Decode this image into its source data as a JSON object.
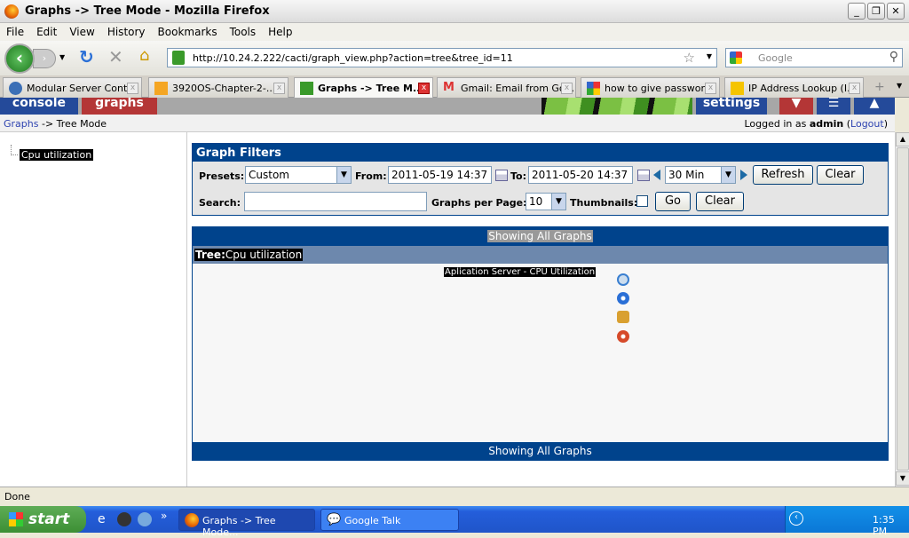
{
  "window": {
    "title": "Graphs -> Tree Mode - Mozilla Firefox"
  },
  "menu": [
    "File",
    "Edit",
    "View",
    "History",
    "Bookmarks",
    "Tools",
    "Help"
  ],
  "nav": {
    "url": "http://10.24.2.222/cacti/graph_view.php?action=tree&tree_id=11",
    "search_placeholder": "Google"
  },
  "tabs": [
    {
      "label": "Modular Server Cont...",
      "active": false
    },
    {
      "label": "3920OS-Chapter-2-...",
      "active": false
    },
    {
      "label": "Graphs -> Tree M...",
      "active": true
    },
    {
      "label": "Gmail: Email from Go...",
      "active": false
    },
    {
      "label": "how to give passwor...",
      "active": false
    },
    {
      "label": "IP Address Lookup (I...",
      "active": false
    }
  ],
  "cacti": {
    "console": "console",
    "graphs": "graphs",
    "settings": "settings"
  },
  "breadcrumb": {
    "link": "Graphs",
    "rest": " -> Tree Mode",
    "logged_prefix": "Logged in as ",
    "user": "admin",
    "logout": "Logout"
  },
  "tree": {
    "item": "Cpu utilization"
  },
  "filters": {
    "title": "Graph Filters",
    "presets_label": "Presets:",
    "presets_value": "Custom",
    "from_label": "From:",
    "from_value": "2011-05-19 14:37",
    "to_label": "To:",
    "to_value": "2011-05-20 14:37",
    "span_value": "30 Min",
    "refresh": "Refresh",
    "clear": "Clear",
    "search_label": "Search:",
    "search_value": "",
    "gpp_label": "Graphs per Page:",
    "gpp_value": "10",
    "thumbs_label": "Thumbnails:",
    "go": "Go",
    "clear2": "Clear"
  },
  "graphs": {
    "showing_top": "Showing All Graphs",
    "tree_label": "Tree:",
    "tree_name": "Cpu utilization",
    "graph_title": "Aplication Server - CPU Utilization",
    "showing_bottom": "Showing All Graphs"
  },
  "status": "Done",
  "taskbar": {
    "start": "start",
    "tasks": [
      "Graphs -> Tree Mode...",
      "Google Talk"
    ],
    "clock": "1:35 PM"
  }
}
